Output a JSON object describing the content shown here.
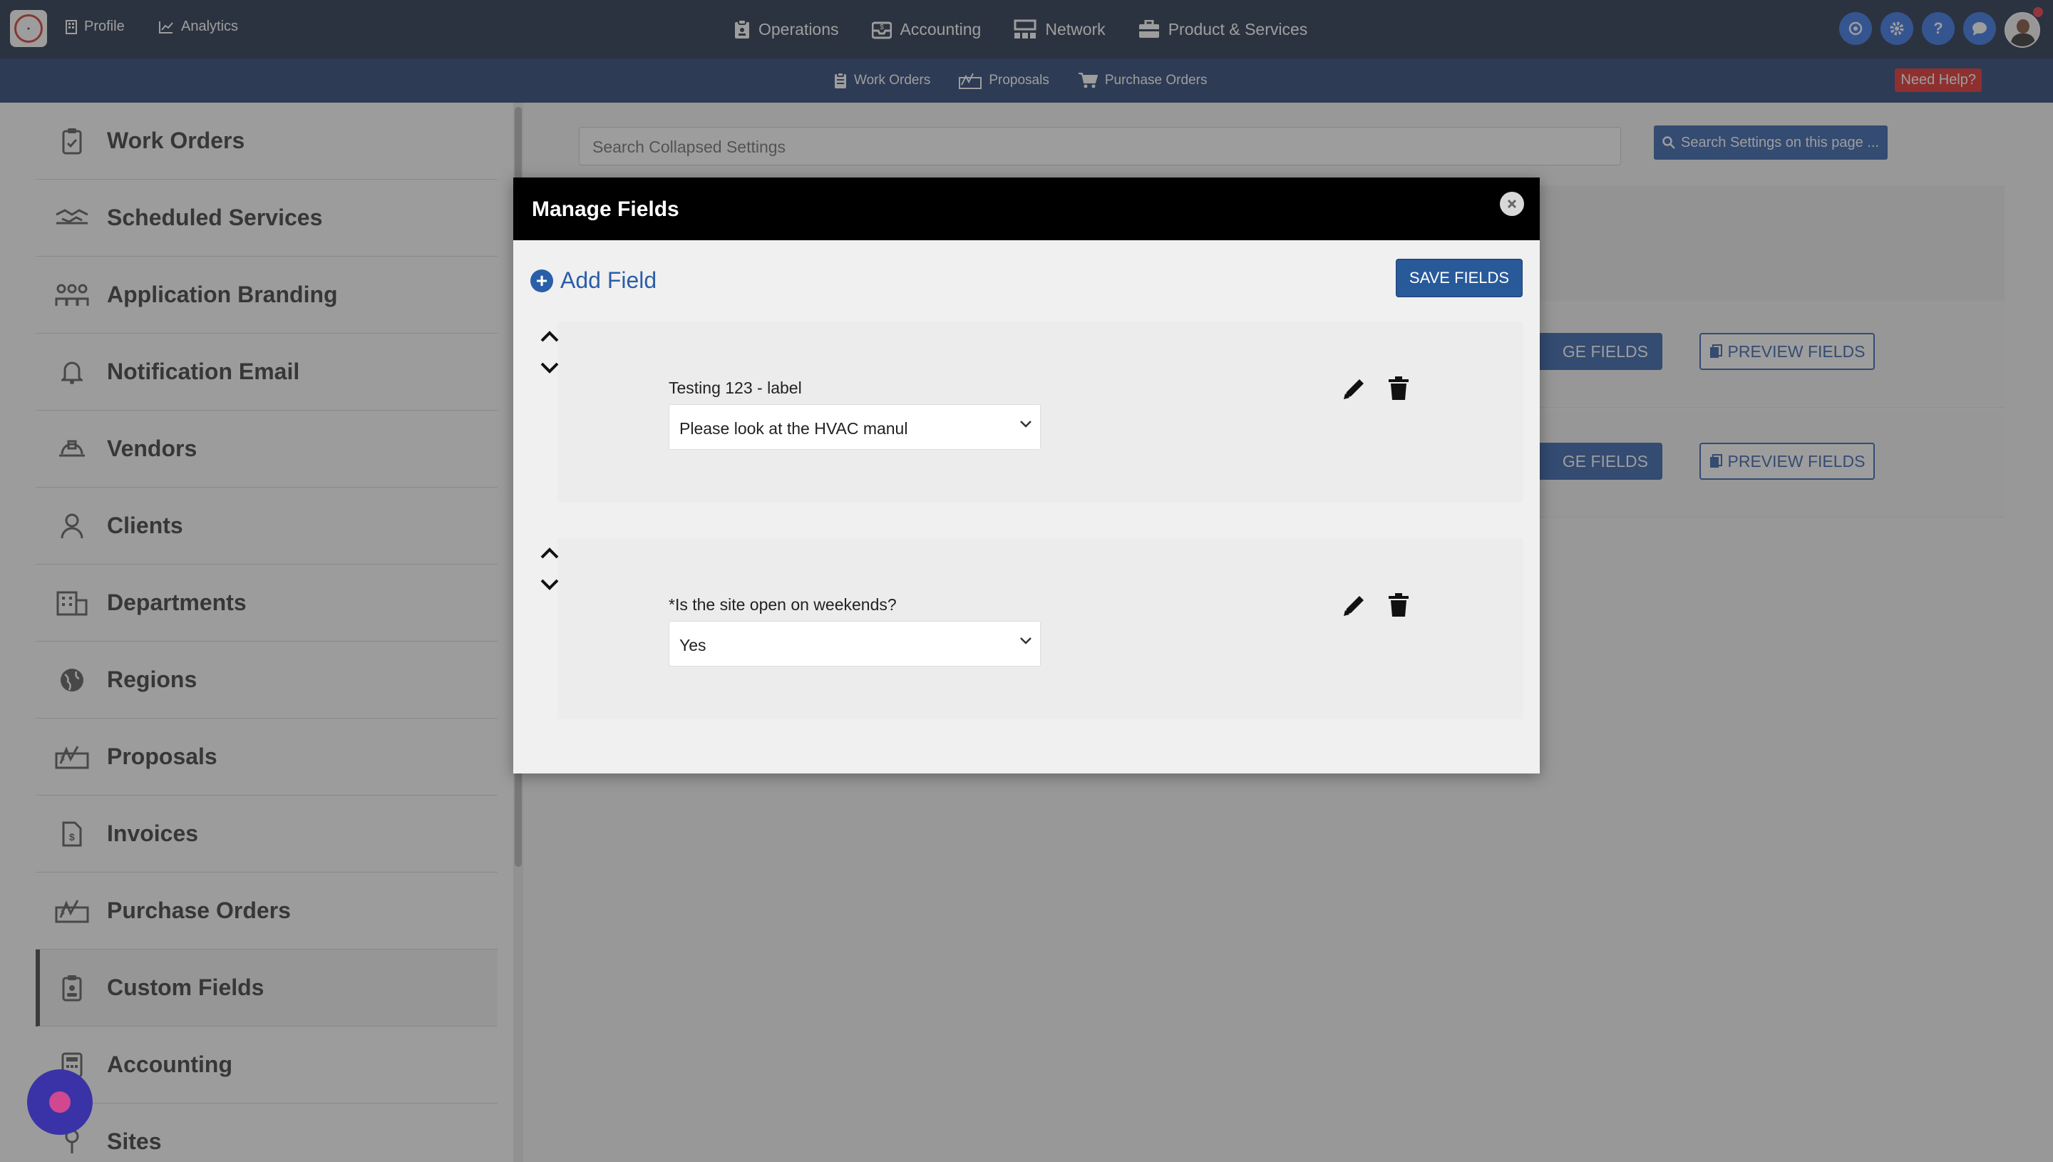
{
  "topbar": {
    "profile_label": "Profile",
    "analytics_label": "Analytics",
    "nav": [
      {
        "label": "Operations",
        "icon": "clipboard-icon"
      },
      {
        "label": "Accounting",
        "icon": "inbox-dollar-icon"
      },
      {
        "label": "Network",
        "icon": "network-icon"
      },
      {
        "label": "Product & Services",
        "icon": "briefcase-icon"
      }
    ],
    "right_buttons": [
      "refresh-icon",
      "gear-icon",
      "help-icon",
      "chat-icon"
    ],
    "help_glyph": "?"
  },
  "subbar": {
    "items": [
      {
        "label": "Work Orders",
        "icon": "clipboard-icon"
      },
      {
        "label": "Proposals",
        "icon": "signature-icon"
      },
      {
        "label": "Purchase Orders",
        "icon": "cart-icon"
      }
    ],
    "need_help": "Need Help?"
  },
  "sidebar": {
    "items": [
      {
        "label": "Work Orders",
        "icon": "clipboard-check-icon"
      },
      {
        "label": "Scheduled Services",
        "icon": "handshake-icon"
      },
      {
        "label": "Application Branding",
        "icon": "people-group-icon"
      },
      {
        "label": "Notification Email",
        "icon": "bell-icon"
      },
      {
        "label": "Vendors",
        "icon": "hard-hat-icon"
      },
      {
        "label": "Clients",
        "icon": "user-icon"
      },
      {
        "label": "Departments",
        "icon": "building-icon"
      },
      {
        "label": "Regions",
        "icon": "globe-icon"
      },
      {
        "label": "Proposals",
        "icon": "signature-icon"
      },
      {
        "label": "Invoices",
        "icon": "invoice-icon"
      },
      {
        "label": "Purchase Orders",
        "icon": "signature-icon"
      },
      {
        "label": "Custom Fields",
        "icon": "clipboard-user-icon"
      },
      {
        "label": "Accounting",
        "icon": "calculator-icon"
      },
      {
        "label": "Sites",
        "icon": "map-pin-icon"
      }
    ],
    "active_index": 11
  },
  "main": {
    "search_placeholder": "Search Collapsed Settings",
    "search_button": "Search Settings on this page ...",
    "rows": [
      {
        "manage_label": "GE FIELDS",
        "preview_label": "PREVIEW FIELDS"
      },
      {
        "manage_label": "GE FIELDS",
        "preview_label": "PREVIEW FIELDS"
      }
    ]
  },
  "modal": {
    "title": "Manage Fields",
    "add_field_label": "Add Field",
    "save_label": "SAVE FIELDS",
    "fields": [
      {
        "label": "Testing 123 - label",
        "value": "Please look at the HVAC manul"
      },
      {
        "label": "*Is the site open on weekends?",
        "value": "Yes"
      }
    ]
  },
  "colors": {
    "topbar": "#1c2b44",
    "subbar": "#1e3b6e",
    "accent": "#2a5ea8",
    "danger": "#e12524"
  }
}
